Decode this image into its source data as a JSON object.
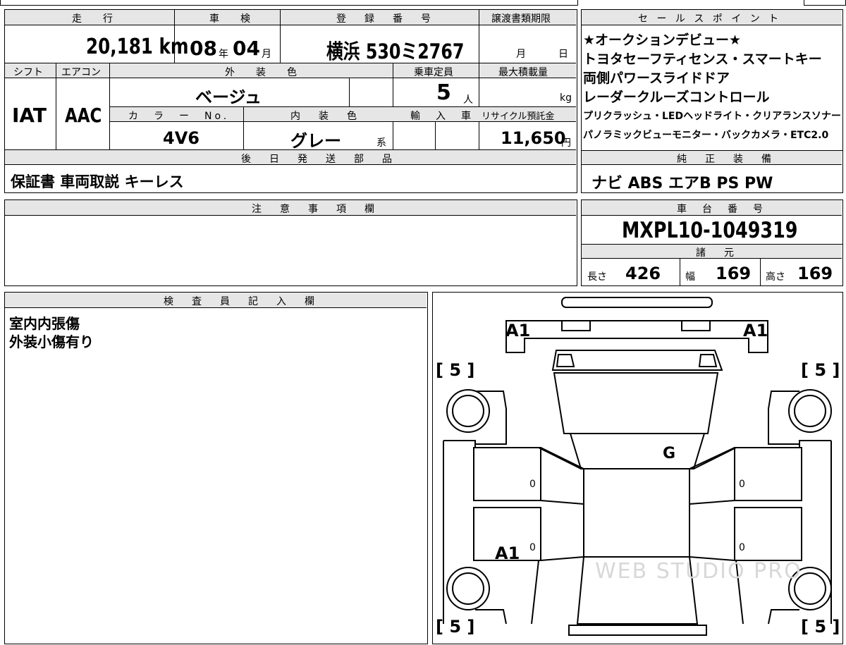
{
  "top_left": {
    "h_mileage": "走　行",
    "h_shaken": "車　検",
    "h_reg": "登　録　番　号",
    "h_doc_deadline": "譲渡書類期限",
    "mileage": "20,181 km",
    "shaken_year": "08",
    "shaken_year_unit": "年",
    "shaken_month": "04",
    "shaken_month_unit": "月",
    "reg_number": "横浜 530ミ2767",
    "doc_month": "月",
    "doc_day": "日",
    "h_shift": "シフト",
    "h_ac": "エアコン",
    "h_ext_color": "外　装　色",
    "h_capacity": "乗車定員",
    "h_max_load": "最大積載量",
    "shift": "IAT",
    "ac": "AAC",
    "ext_color": "ベージュ",
    "capacity": "5",
    "capacity_unit": "人",
    "max_load_unit": "kg",
    "h_color_no": "カ　ラ　ー　No.",
    "h_int_color": "内　装　色",
    "h_import": "輸　入　車",
    "h_recycle": "リサイクル預託金",
    "color_no": "4V6",
    "int_color": "グレー",
    "int_color_suffix": "系",
    "recycle_fee": "11,650",
    "recycle_unit": "円",
    "h_later_parts": "後　日　発　送　部　品",
    "later_parts": "保証書 車両取説 キーレス"
  },
  "sales_points": {
    "header": "セ ー ル ス ポ イ ン ト",
    "lines": [
      "★オークションデビュー★",
      "トヨタセーフティセンス・スマートキー",
      "両側パワースライドドア",
      "レーダークルーズコントロール",
      "プリクラッシュ・LEDヘッドライト・クリアランスソナー",
      "パノラミックビューモニター・バックカメラ・ETC2.0"
    ]
  },
  "genuine_equipment": {
    "header": "純　正　装　備",
    "value": "ナビ ABS エアB PS PW"
  },
  "notes": {
    "header": "注　意　事　項　欄",
    "value": ""
  },
  "chassis": {
    "header": "車　台　番　号",
    "value": "MXPL10-1049319"
  },
  "specs": {
    "header": "諸　元",
    "length_label": "長さ",
    "length": "426",
    "width_label": "幅",
    "width": "169",
    "height_label": "高さ",
    "height": "169"
  },
  "inspector": {
    "header": "検　査　員　記　入　欄",
    "lines": [
      "室内内張傷",
      "外装小傷有り"
    ]
  },
  "diagram": {
    "marks": {
      "front_left": "A1",
      "front_right": "A1",
      "roof": "G",
      "rear_left_door": "A1"
    },
    "tire_left_front": "[ 5 ]",
    "tire_right_front": "[ 5 ]",
    "tire_left_rear": "[ 5 ]",
    "tire_right_rear": "[ 5 ]",
    "door_zero": "0",
    "watermark": "WEB STUDIO PRO"
  }
}
